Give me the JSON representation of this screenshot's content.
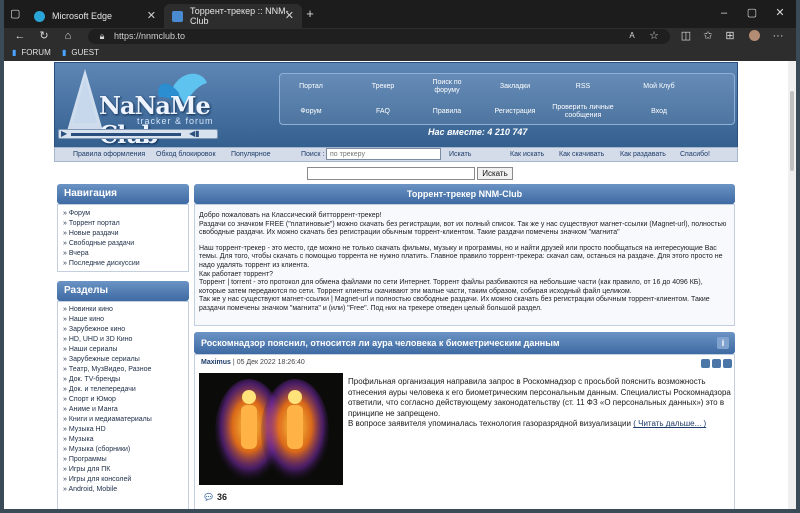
{
  "browser": {
    "tabs": [
      {
        "title": "Microsoft Edge",
        "active": false
      },
      {
        "title": "Торрент-трекер :: NNM-Club",
        "active": true
      }
    ],
    "address": "https://nnmclub.to",
    "bookmarks": [
      "FORUM",
      "GUEST"
    ],
    "accent": "#5e86b5"
  },
  "site": {
    "logo_title": "NaNaMe Club",
    "logo_sub": "tracker & forum",
    "nav": [
      [
        "Портал",
        "Трекер",
        "Поиск по форуму",
        "Закладки",
        "RSS",
        "Мой Клуб"
      ],
      [
        "Форум",
        "FAQ",
        "Правила",
        "Регистрация",
        "Проверить личные сообщения",
        "Вход"
      ]
    ],
    "online": "Нас вместе: 4 210 747",
    "links": [
      "Правила оформления",
      "Обход блокировок",
      "Популярное",
      "Поиск :",
      "Искать",
      "Как искать",
      "Как скачивать",
      "Как раздавать",
      "Спасибо!"
    ],
    "search_placeholder": "по трекеру",
    "search_button": "Искать"
  },
  "sidebar": {
    "nav_title": "Навигация",
    "nav_items": [
      "Форум",
      "Торрент портал",
      "Новые раздачи",
      "Свободные раздачи",
      "Вчера",
      "Последние дискуссии"
    ],
    "sections_title": "Разделы",
    "section_items": [
      "Новинки кино",
      "Наше кино",
      "Зарубежное кино",
      "HD, UHD и 3D Кино",
      "Наши сериалы",
      "Зарубежные сериалы",
      "Театр, МузВидео, Разное",
      "Док. TV-бренды",
      "Док. и телепередачи",
      "Спорт и Юмор",
      "Аниме и Манга",
      "Книги и медиаматериалы",
      "Музыка HD",
      "Музыка",
      "Музыка (сборники)",
      "Программы",
      "Игры для ПК",
      "Игры для консолей",
      "Android, Mobile"
    ]
  },
  "main": {
    "title": "Торрент-трекер NNM-Club",
    "p1": "Добро пожаловать на Классический битторрент-трекер!",
    "p2": "Раздачи со значком FREE (\"платиновые\") можно скачать без регистрации, вот их полный список. Так же у нас существуют магнет-ссылки (Magnet-url), полностью свободные раздачи. Их можно скачать без регистрации обычным торрент-клиентом. Такие раздачи помечены значком \"магнита\"",
    "p3": "Наш торрент-трекер - это место, где можно не только скачать фильмы, музыку и программы, но и найти друзей или просто пообщаться на интересующие Вас темы. Для того, чтобы скачать с помощью торрента не нужно платить. Главное правило торрент-трекера: скачал сам, останься на раздаче. Для этого просто не надо удалять торрент из клиента.",
    "p4": "Как работает торрент?",
    "p5": "Торрент | torrent - это протокол для обмена файлами по сети Интернет. Торрент файлы разбиваются на небольшие части (как правило, от 16 до 4096 КБ), которые затем передаются по сети. Торрент клиенты скачивают эти малые части, таким образом, собирая исходный файл целиком.",
    "p6": "Так же у нас существуют магнет-ссылки | Magnet-url и полностью свободные раздачи. Их можно скачать без регистрации обычным торрент-клиентом. Такие раздачи помечены значком \"магнита\" и (или) \"Free\". Под них на трекере отведен целый большой раздел."
  },
  "news": {
    "title": "Роскомнадзор пояснил, относится ли аура человека к биометрическим данным",
    "author": "Maximus",
    "date": "05 Дек 2022 18:26:40",
    "text": "Профильная организация направила запрос в Роскомнадзор с просьбой пояснить возможность отнесения ауры человека к его биометрическим персональным данным. Специалисты Роскомнадзора ответили, что согласно действующему законодательству (ст. 11 ФЗ «О персональных данных») это в принципе не запрещено.",
    "text2": "В вопросе заявителя упоминалась технология газоразрядной визуализации",
    "more": "( Читать дальше... )",
    "comments": "36"
  }
}
